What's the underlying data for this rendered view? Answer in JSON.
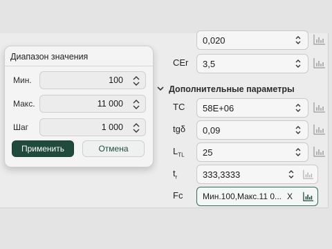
{
  "popover": {
    "title": "Диапазон значения",
    "fields": [
      {
        "label": "Мин.",
        "value": "100"
      },
      {
        "label": "Макс.",
        "value": "11 000"
      },
      {
        "label": "Шаг",
        "value": "1 000"
      }
    ],
    "apply_label": "Применить",
    "cancel_label": "Отмена"
  },
  "params": {
    "top_value": "0,020",
    "cer": {
      "label": "CEr",
      "value": "3,5"
    },
    "section_title": "Дополнительные параметры",
    "tc": {
      "label": "TC",
      "value": "58E+06"
    },
    "tgd": {
      "label": "tgδ",
      "value": "0,09"
    },
    "ltl": {
      "label_main": "L",
      "label_sub": "TL",
      "value": "25"
    },
    "tr": {
      "label_main": "t",
      "label_sub": "r",
      "value": "333,3333"
    },
    "fc": {
      "label": "Fc",
      "value": "Мин.100,Макс.11 0...",
      "clear": "X"
    }
  },
  "colors": {
    "accent": "#1f4a3c",
    "background": "#ececec"
  },
  "icons": {
    "chevron": "chevron-up-down-icon",
    "chart": "bar-chart-icon",
    "section": "chevron-down-icon"
  }
}
